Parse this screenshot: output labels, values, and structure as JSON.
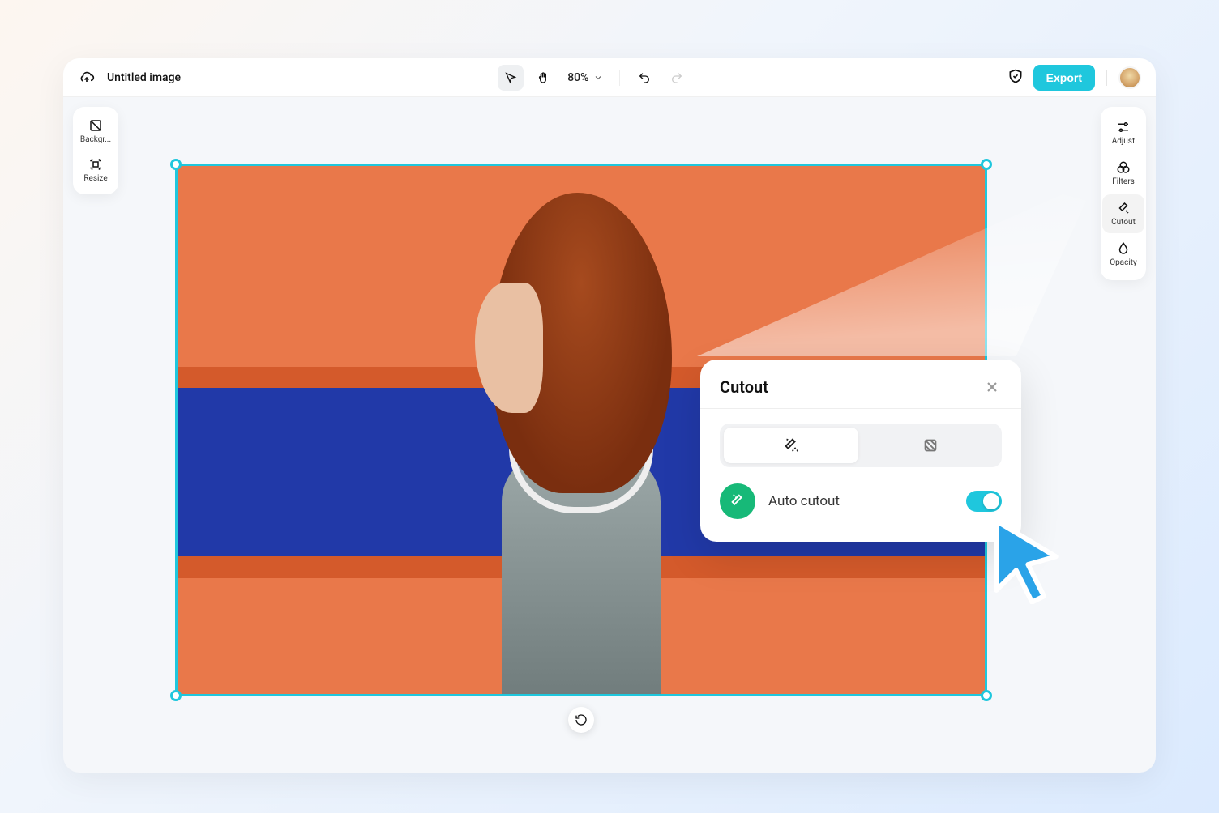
{
  "header": {
    "title": "Untitled image",
    "zoom_label": "80%",
    "export_label": "Export"
  },
  "left_tools": [
    {
      "name": "background",
      "label": "Backgr..."
    },
    {
      "name": "resize",
      "label": "Resize"
    }
  ],
  "right_tools": [
    {
      "name": "adjust",
      "label": "Adjust",
      "selected": false
    },
    {
      "name": "filters",
      "label": "Filters",
      "selected": false
    },
    {
      "name": "cutout",
      "label": "Cutout",
      "selected": true
    },
    {
      "name": "opacity",
      "label": "Opacity",
      "selected": false
    }
  ],
  "cutout_popup": {
    "title": "Cutout",
    "tabs": {
      "auto_selected": true
    },
    "auto_row": {
      "label": "Auto cutout",
      "enabled": true
    }
  },
  "colors": {
    "accent": "#1fc7dd",
    "success": "#17b978"
  }
}
